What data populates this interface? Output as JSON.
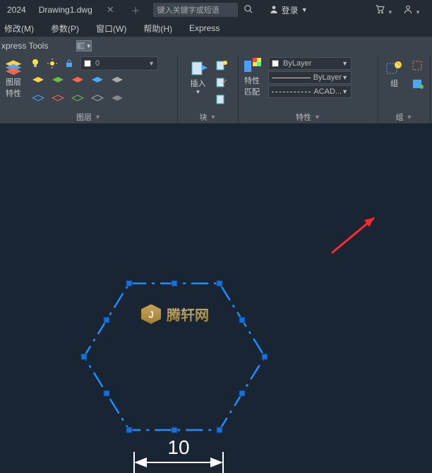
{
  "title": {
    "year": "2024",
    "filename": "Drawing1.dwg",
    "search_placeholder": "键入关键字或短语",
    "login": "登录"
  },
  "menu": {
    "modify": "修改(M)",
    "params": "参数(P)",
    "window": "窗口(W)",
    "help": "帮助(H)",
    "express": "Express"
  },
  "ribbontab": {
    "name": "xpress Tools"
  },
  "layers": {
    "panel_label": "图层",
    "big_label": "图层\n特性",
    "current": "0"
  },
  "block": {
    "panel_label": "块",
    "big_label": "插入"
  },
  "props": {
    "panel_label": "特性",
    "big_label": "特性\n匹配",
    "bylayer1": "ByLayer",
    "bylayer2": "ByLayer",
    "acad": "ACAD..."
  },
  "groupsPanel": {
    "panel_label": "组",
    "big_label": "组"
  },
  "drawing": {
    "dim_value": "10"
  },
  "watermark": {
    "text": "腾轩网",
    "glyph": "J"
  }
}
